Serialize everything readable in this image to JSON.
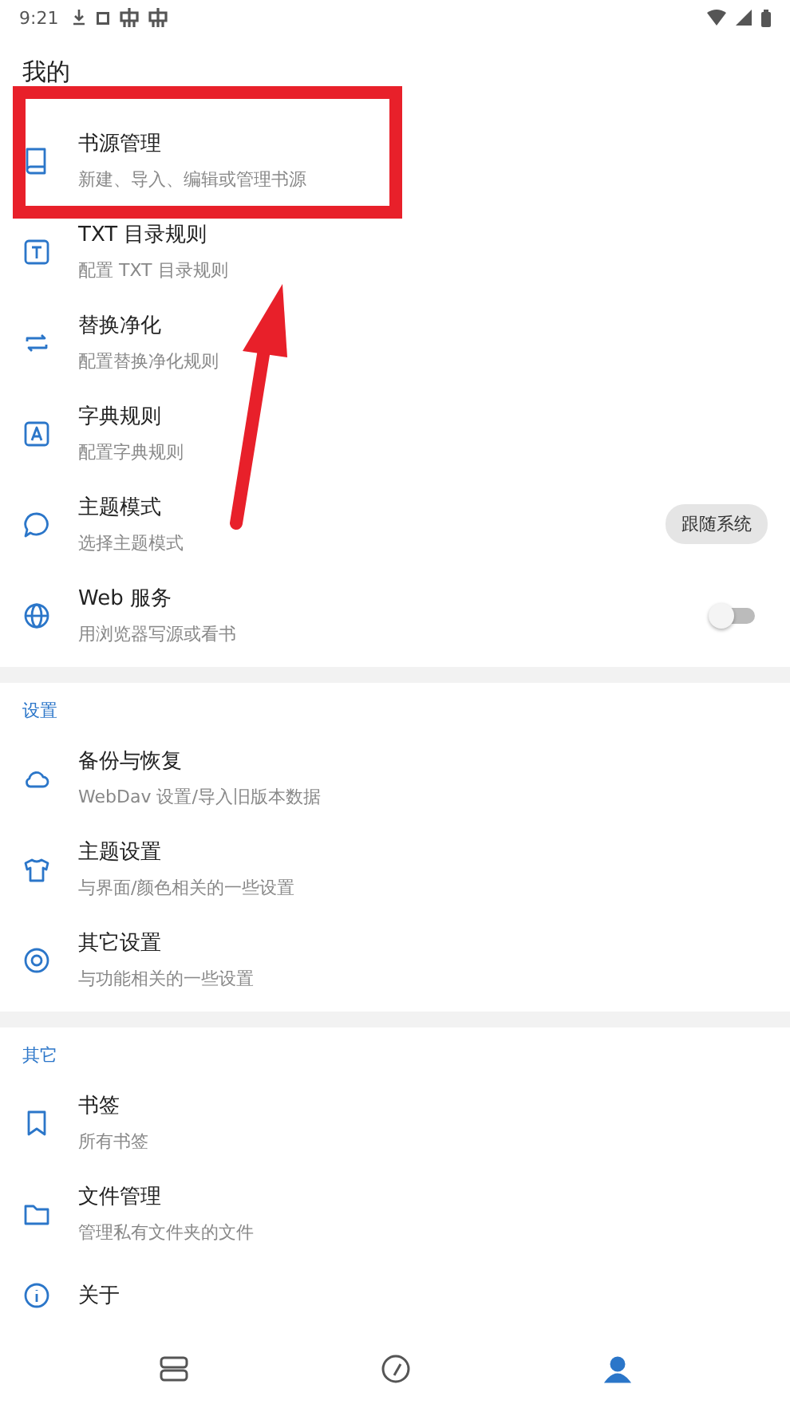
{
  "status_bar": {
    "time": "9:21"
  },
  "header": {
    "title": "我的"
  },
  "sections": [
    {
      "items": [
        {
          "title": "书源管理",
          "subtitle": "新建、导入、编辑或管理书源"
        },
        {
          "title": "TXT 目录规则",
          "subtitle": "配置 TXT 目录规则"
        },
        {
          "title": "替换净化",
          "subtitle": "配置替换净化规则"
        },
        {
          "title": "字典规则",
          "subtitle": "配置字典规则"
        },
        {
          "title": "主题模式",
          "subtitle": "选择主题模式",
          "trailing": {
            "kind": "chip",
            "text": "跟随系统"
          }
        },
        {
          "title": "Web 服务",
          "subtitle": "用浏览器写源或看书",
          "trailing": {
            "kind": "switch",
            "on": false
          }
        }
      ]
    },
    {
      "title": "设置",
      "items": [
        {
          "title": "备份与恢复",
          "subtitle": "WebDav 设置/导入旧版本数据"
        },
        {
          "title": "主题设置",
          "subtitle": "与界面/颜色相关的一些设置"
        },
        {
          "title": "其它设置",
          "subtitle": "与功能相关的一些设置"
        }
      ]
    },
    {
      "title": "其它",
      "items": [
        {
          "title": "书签",
          "subtitle": "所有书签"
        },
        {
          "title": "文件管理",
          "subtitle": "管理私有文件夹的文件"
        },
        {
          "title": "关于"
        }
      ]
    }
  ],
  "bottom_nav": [
    {
      "selected": false
    },
    {
      "selected": false
    },
    {
      "selected": true
    }
  ]
}
